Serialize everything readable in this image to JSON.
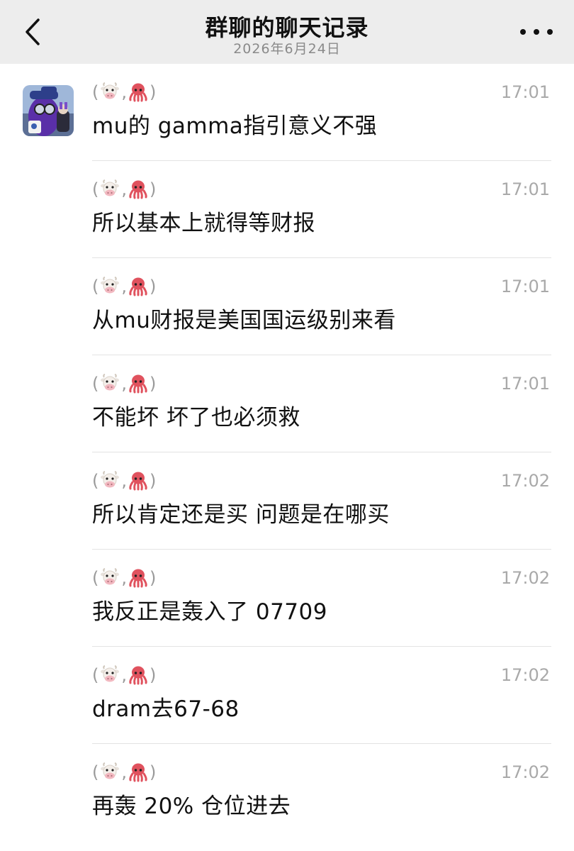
{
  "header": {
    "title": "群聊的聊天记录",
    "date": "2026年6月24日"
  },
  "sender": {
    "prefix": "(",
    "separator": ",",
    "suffix": ")",
    "emoji": [
      "cow-face",
      "octopus"
    ]
  },
  "messages": [
    {
      "time": "17:01",
      "text": "mu的 gamma指引意义不强"
    },
    {
      "time": "17:01",
      "text": "所以基本上就得等财报"
    },
    {
      "time": "17:01",
      "text": "从mu财报是美国国运级别来看"
    },
    {
      "time": "17:01",
      "text": "不能坏 坏了也必须救"
    },
    {
      "time": "17:02",
      "text": "所以肯定还是买 问题是在哪买"
    },
    {
      "time": "17:02",
      "text": "我反正是轰入了 07709"
    },
    {
      "time": "17:02",
      "text": "dram去67-68"
    },
    {
      "time": "17:02",
      "text": "再轰 20% 仓位进去"
    }
  ],
  "icons": {
    "back": "chevron-left-icon",
    "more": "more-dots-icon"
  },
  "colors": {
    "nav_bg": "#ededed",
    "muted": "#9a9a9a",
    "avatar_purple": "#5a2fa8"
  }
}
